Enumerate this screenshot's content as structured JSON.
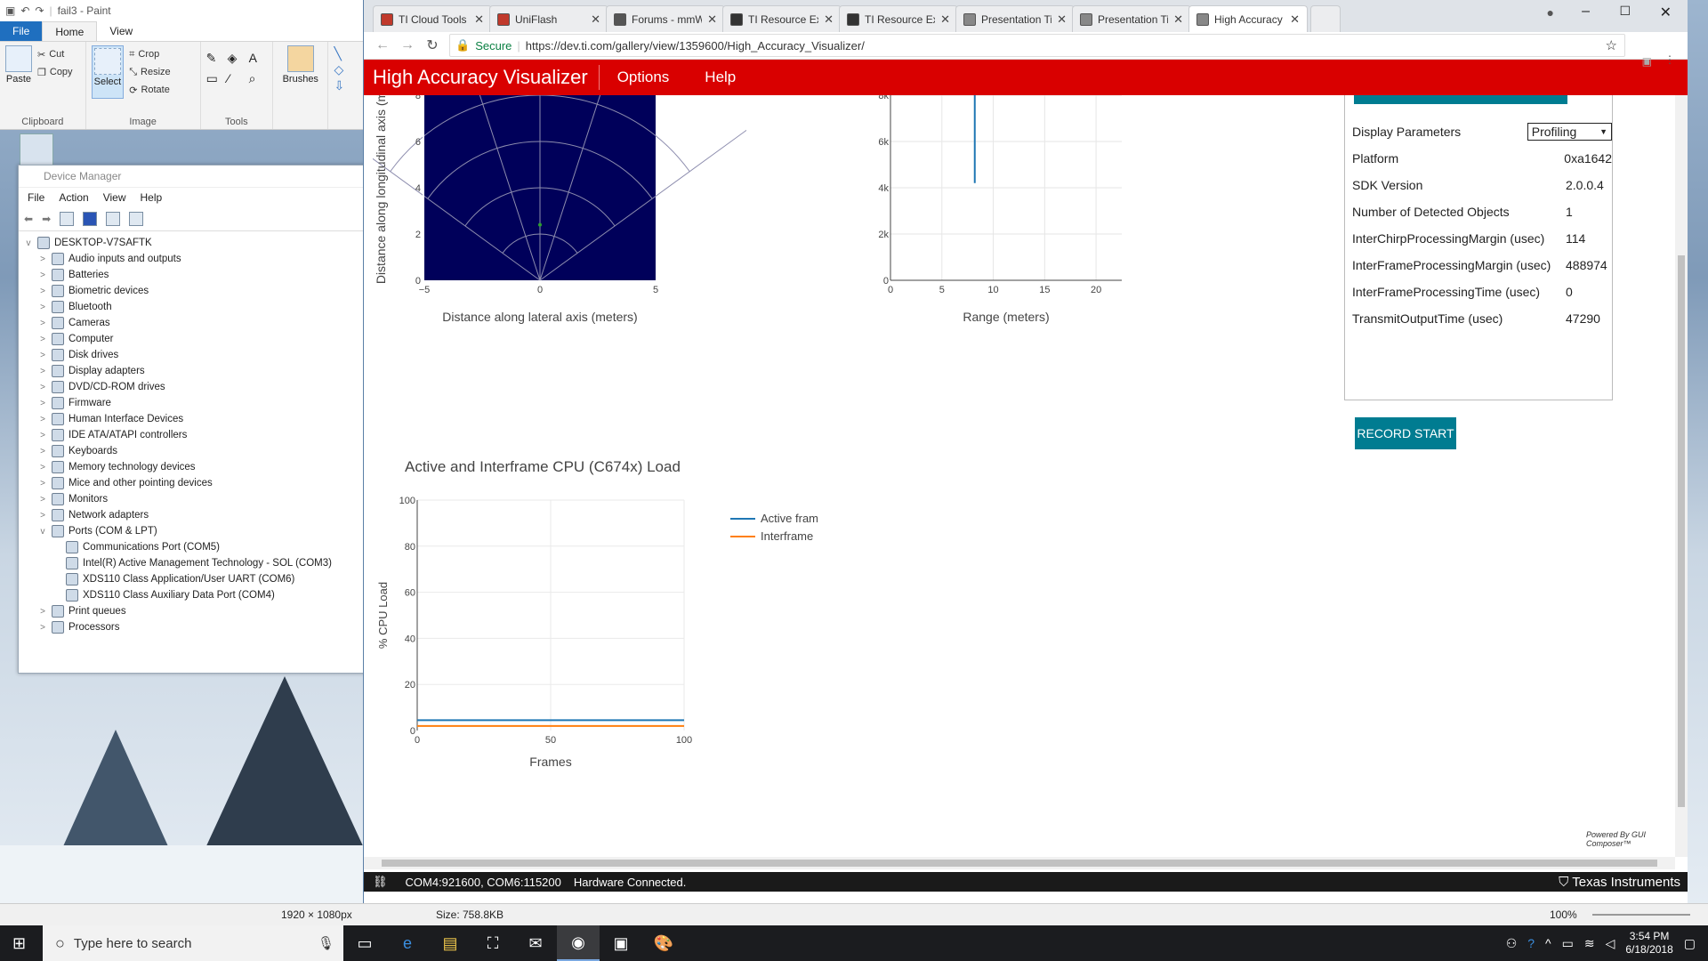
{
  "paint": {
    "title": "fail3 - Paint",
    "tabs": [
      "File",
      "Home",
      "View"
    ],
    "clipboard": {
      "paste": "Paste",
      "cut": "Cut",
      "copy": "Copy",
      "label": "Clipboard"
    },
    "image": {
      "select": "Select",
      "crop": "Crop",
      "resize": "Resize",
      "rotate": "Rotate",
      "label": "Image"
    },
    "tools": {
      "label": "Tools"
    },
    "brushes": "Brushes",
    "status": {
      "dims": "1920 × 1080px",
      "size": "Size: 758.8KB",
      "zoom": "100%"
    }
  },
  "devmgr": {
    "title": "Device Manager",
    "menu": [
      "File",
      "Action",
      "View",
      "Help"
    ],
    "root": "DESKTOP-V7SAFTK",
    "items": [
      {
        "label": "Audio inputs and outputs",
        "exp": ">"
      },
      {
        "label": "Batteries",
        "exp": ">"
      },
      {
        "label": "Biometric devices",
        "exp": ">"
      },
      {
        "label": "Bluetooth",
        "exp": ">"
      },
      {
        "label": "Cameras",
        "exp": ">"
      },
      {
        "label": "Computer",
        "exp": ">"
      },
      {
        "label": "Disk drives",
        "exp": ">"
      },
      {
        "label": "Display adapters",
        "exp": ">"
      },
      {
        "label": "DVD/CD-ROM drives",
        "exp": ">"
      },
      {
        "label": "Firmware",
        "exp": ">"
      },
      {
        "label": "Human Interface Devices",
        "exp": ">"
      },
      {
        "label": "IDE ATA/ATAPI controllers",
        "exp": ">"
      },
      {
        "label": "Keyboards",
        "exp": ">"
      },
      {
        "label": "Memory technology devices",
        "exp": ">"
      },
      {
        "label": "Mice and other pointing devices",
        "exp": ">"
      },
      {
        "label": "Monitors",
        "exp": ">"
      },
      {
        "label": "Network adapters",
        "exp": ">"
      },
      {
        "label": "Ports (COM & LPT)",
        "exp": "v"
      }
    ],
    "ports": [
      "Communications Port (COM5)",
      "Intel(R) Active Management Technology - SOL (COM3)",
      "XDS110 Class Application/User UART (COM6)",
      "XDS110 Class Auxiliary Data Port (COM4)"
    ],
    "after": [
      {
        "label": "Print queues",
        "exp": ">"
      },
      {
        "label": "Processors",
        "exp": ">"
      }
    ]
  },
  "browser": {
    "tabs": [
      {
        "title": "TI Cloud Tools",
        "color": "#c0392b"
      },
      {
        "title": "UniFlash",
        "color": "#c0392b"
      },
      {
        "title": "Forums - mmWave",
        "color": "#555555"
      },
      {
        "title": "TI Resource Explore",
        "color": "#333333"
      },
      {
        "title": "TI Resource Explore",
        "color": "#333333"
      },
      {
        "title": "Presentation Title H",
        "color": "#888888"
      },
      {
        "title": "Presentation Title H",
        "color": "#888888"
      },
      {
        "title": "High Accuracy Visu",
        "color": "#888888"
      }
    ],
    "secure": "Secure",
    "url": "https://dev.ti.com/gallery/view/1359600/High_Accuracy_Visualizer/"
  },
  "app": {
    "name": "High Accuracy Visualizer",
    "menu": [
      "Options",
      "Help"
    ],
    "params_label": "Display Parameters",
    "params_select": "Profiling",
    "params": [
      {
        "k": "Platform",
        "v": "0xa1642"
      },
      {
        "k": "SDK Version",
        "v": "2.0.0.4"
      },
      {
        "k": "Number of Detected Objects",
        "v": "1"
      },
      {
        "k": "InterChirpProcessingMargin (usec)",
        "v": "114"
      },
      {
        "k": "InterFrameProcessingMargin (usec)",
        "v": "488974"
      },
      {
        "k": "InterFrameProcessingTime (usec)",
        "v": "0"
      },
      {
        "k": "TransmitOutputTime (usec)",
        "v": "47290"
      }
    ],
    "record": "RECORD START",
    "powered": "Powered By GUI Composer™",
    "status": {
      "ports": "COM4:921600, COM6:115200",
      "conn": "Hardware Connected.",
      "brand": "Texas Instruments"
    }
  },
  "chart_data": [
    {
      "type": "scatter",
      "xlabel": "Distance along lateral axis (meters)",
      "ylabel": "Distance along longitudinal axis (m",
      "x_ticks": [
        "−5",
        "0",
        "5"
      ],
      "y_ticks": [
        "0",
        "2",
        "4",
        "6",
        "8"
      ],
      "xlim": [
        -5,
        5
      ],
      "ylim": [
        0,
        8
      ],
      "points": [
        {
          "x": 0,
          "y": 2.4
        }
      ],
      "bg": "#00005a"
    },
    {
      "type": "line",
      "xlabel": "Range (meters)",
      "x_ticks": [
        "0",
        "5",
        "10",
        "15",
        "20"
      ],
      "y_ticks": [
        "0",
        "2k",
        "4k",
        "6k",
        "8k"
      ],
      "xlim": [
        0,
        22.5
      ],
      "ylim": [
        0,
        8000
      ],
      "series": [
        {
          "x": [
            8.2,
            8.2
          ],
          "y": [
            4200,
            8000
          ]
        }
      ]
    },
    {
      "type": "line",
      "title": "Active and Interframe  CPU (C674x) Load",
      "xlabel": "Frames",
      "ylabel": "% CPU Load",
      "x_ticks": [
        "0",
        "50",
        "100"
      ],
      "y_ticks": [
        "0",
        "20",
        "40",
        "60",
        "80",
        "100"
      ],
      "xlim": [
        0,
        100
      ],
      "ylim": [
        0,
        100
      ],
      "series": [
        {
          "name": "Active frame",
          "color": "#1f77b4",
          "x": [
            0,
            100
          ],
          "y": [
            4.5,
            4.5
          ]
        },
        {
          "name": "Interframe",
          "color": "#ff7f0e",
          "x": [
            0,
            100
          ],
          "y": [
            2,
            2
          ]
        }
      ]
    }
  ],
  "taskbar": {
    "search": "Type here to search",
    "time": "3:54 PM",
    "date": "6/18/2018"
  },
  "colors": {
    "ti_red": "#d90000",
    "teal": "#007c91",
    "active": "#1f77b4",
    "inter": "#ff7f0e"
  }
}
